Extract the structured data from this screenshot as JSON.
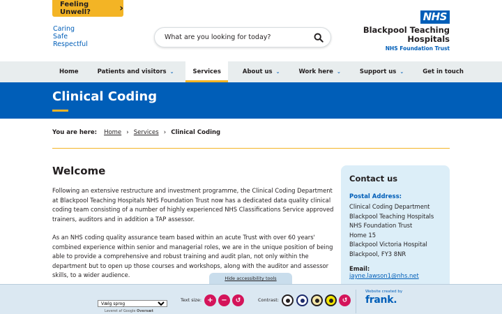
{
  "header": {
    "feeling_unwell": "Feeling Unwell?",
    "tagline": [
      "Caring",
      "Safe",
      "Respectful"
    ],
    "search_placeholder": "What are you looking for today?",
    "logo": {
      "badge": "NHS",
      "org_line1": "Blackpool Teaching",
      "org_line2": "Hospitals",
      "trust": "NHS Foundation Trust"
    }
  },
  "nav": {
    "items": [
      {
        "label": "Home",
        "dropdown": false
      },
      {
        "label": "Patients and visitors",
        "dropdown": true
      },
      {
        "label": "Services",
        "dropdown": false,
        "active": true
      },
      {
        "label": "About us",
        "dropdown": true
      },
      {
        "label": "Work here",
        "dropdown": true
      },
      {
        "label": "Support us",
        "dropdown": true
      },
      {
        "label": "Get in touch",
        "dropdown": false
      }
    ]
  },
  "hero": {
    "title": "Clinical Coding"
  },
  "breadcrumb": {
    "label": "You are here:",
    "home": "Home",
    "services": "Services",
    "current": "Clinical Coding"
  },
  "main": {
    "heading": "Welcome",
    "paragraph1": "Following an extensive restructure and investment programme, the Clinical Coding Department at Blackpool Teaching Hospitals NHS Foundation Trust now has a dedicated data quality clinical coding team consisting of a number of highly experienced NHS Classifications Service approved trainers, auditors and in addition a TAP assessor.",
    "paragraph2": "As an NHS coding quality assurance team based within an acute Trust with over 60 years' combined experience within senior and managerial roles, we are in the unique position of being able to provide a comprehensive and robust training and audit plan, not only within the department but to open up those courses and workshops, along with the auditor and assessor skills, to a wider audience."
  },
  "contact": {
    "title": "Contact us",
    "postal_label": "Postal Address:",
    "address": [
      "Clinical Coding Department",
      "Blackpool Teaching Hospitals",
      "NHS Foundation Trust",
      "Home 15",
      "Blackpool Victoria Hospital",
      "Blackpool, FY3 8NR"
    ],
    "email_label": "Email:",
    "email": "jayne.lawson1@nhs.net"
  },
  "accessibility": {
    "hide_tools": "Hide accessibility tools",
    "language_select": "Vælg sprog",
    "powered_by": "Leveret af",
    "google": "Google",
    "translate": "Oversæt",
    "text_size_label": "Text size:",
    "contrast_label": "Contrast:",
    "website_created_by": "Website created by",
    "frank": "frank."
  },
  "colors": {
    "nhs_blue": "#005eb8",
    "accent_yellow": "#f3b425",
    "tool_pink": "#d4145a"
  }
}
